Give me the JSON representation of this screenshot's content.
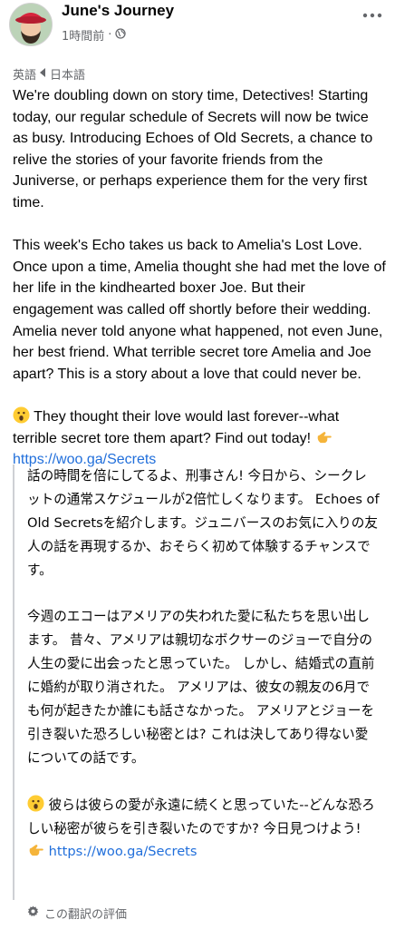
{
  "header": {
    "page_name": "June's Journey",
    "timestamp": "1時間前",
    "separator": "·",
    "privacy_icon": "globe-icon",
    "more_icon": "more-dots-icon"
  },
  "translation_bar": {
    "source_lang": "英語",
    "arrow_icon": "caret-left-icon",
    "target_lang": "日本語"
  },
  "post": {
    "paragraph1": "We're doubling down on story time, Detectives! Starting today, our regular schedule of Secrets will now be twice as busy. Introducing Echoes of Old Secrets, a chance to relive the stories of your favorite friends from the Juniverse, or perhaps experience them for the very first time.",
    "paragraph2": "This week's Echo takes us back to Amelia's Lost Love. Once upon a time, Amelia thought she had met the love of her life in the kindhearted boxer Joe. But their engagement was called off shortly before their wedding. Amelia never told anyone what happened, not even June, her best friend. What terrible secret tore Amelia and Joe apart? This is a story about a love that could never be.",
    "paragraph3": "They thought their love would last forever--what terrible secret tore them apart? Find out today!",
    "link": "https://woo.ga/Secrets"
  },
  "translated": {
    "paragraph1": "話の時間を倍にしてるよ、刑事さん! 今日から、シークレットの通常スケジュールが2倍忙しくなります。 Echoes of Old Secretsを紹介します。ジュニバースのお気に入りの友人の話を再現するか、おそらく初めて体験するチャンスです。",
    "paragraph2": "今週のエコーはアメリアの失われた愛に私たちを思い出します。 昔々、アメリアは親切なボクサーのジョーで自分の人生の愛に出会ったと思っていた。 しかし、結婚式の直前に婚約が取り消された。 アメリアは、彼女の親友の6月でも何が起きたか誰にも話さなかった。 アメリアとジョーを引き裂いた恐ろしい秘密とは? これは決してあり得ない愛についての話です。",
    "paragraph3": "彼らは彼らの愛が永遠に続くと思っていた--どんな恐ろしい秘密が彼らを引き裂いたのですか? 今日見つけよう!",
    "link": "https://woo.ga/Secrets"
  },
  "rate_translation": {
    "icon": "gear-icon",
    "label": "この翻訳の評価"
  },
  "colors": {
    "link": "#216fdb",
    "secondary_text": "#65676b",
    "quote_bar": "#ced0d4"
  }
}
